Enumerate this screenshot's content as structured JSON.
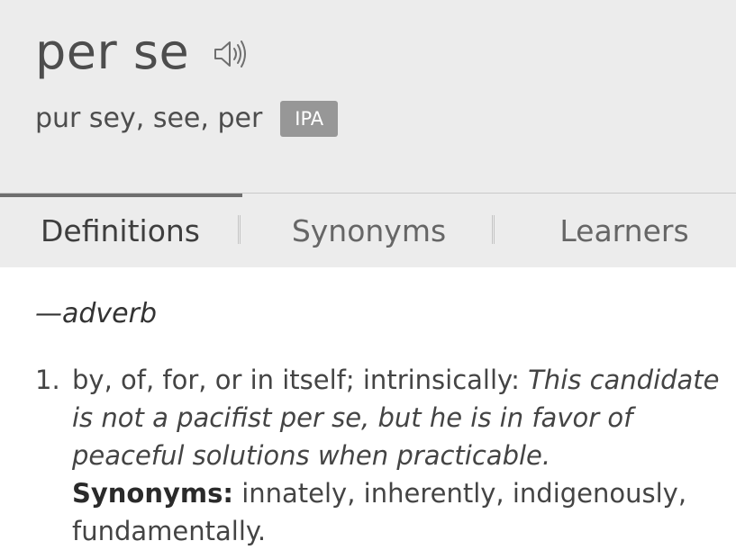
{
  "entry": {
    "headword": "per se",
    "pronunciation": "pur sey, see, per",
    "ipa_label": "IPA",
    "speaker_icon": "speaker-icon"
  },
  "tabs": [
    {
      "label": "Definitions",
      "active": true
    },
    {
      "label": "Synonyms",
      "active": false
    },
    {
      "label": "Learners",
      "active": false
    }
  ],
  "definitions": {
    "part_of_speech": "—adverb",
    "items": [
      {
        "number": "1.",
        "text": "by, of, for, or in itself; intrinsically: ",
        "example": "This candidate is not a pacifist per se, but he is in favor of peaceful solutions when practicable.",
        "synonyms_label": "Synonyms:",
        "synonyms": "innately, inherently, indigenously, fundamentally."
      }
    ]
  },
  "colors": {
    "header_bg": "#ececec",
    "ipa_bg": "#979797",
    "active_tab_indicator": "#6e6e6e"
  }
}
